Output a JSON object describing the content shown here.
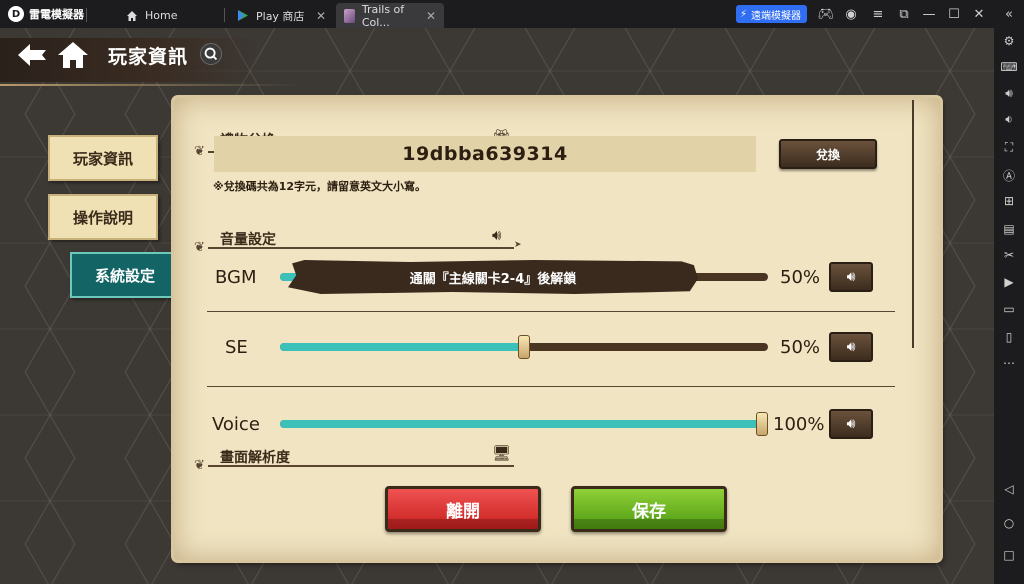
{
  "emulator": {
    "app_name": "雷電模擬器",
    "tabs": [
      {
        "label": "Home",
        "icon": "home-icon"
      },
      {
        "label": "Play 商店",
        "icon": "play-store-icon"
      },
      {
        "label": "Trails of Col...",
        "icon": "game-icon"
      }
    ],
    "cloud_button": "遠端模擬器",
    "accent": "#2f6df2"
  },
  "game": {
    "page_title": "玩家資訊",
    "menu": [
      "玩家資訊",
      "操作說明",
      "系統設定"
    ],
    "active_menu": "系統設定",
    "gift": {
      "section_label": "禮物兌換",
      "code": "19dbba639314",
      "redeem_button": "兌換",
      "note": "※兌換碼共為12字元，請留意英文大小寫。"
    },
    "volume": {
      "section_label": "音量設定",
      "bgm": {
        "label": "BGM",
        "value": "50%",
        "level": 0.5
      },
      "lock_message": "通關『主線關卡2-4』後解鎖",
      "se": {
        "label": "SE",
        "value": "50%",
        "level": 0.5
      },
      "voice": {
        "label": "Voice",
        "value": "100%",
        "level": 1.0
      }
    },
    "resolution_label": "畫面解析度",
    "leave_button": "離開",
    "save_button": "保存",
    "colors": {
      "slider_fill": "#3cc0ba",
      "leave": "#d83030",
      "save": "#6bb224",
      "active_tab": "#126564"
    }
  }
}
